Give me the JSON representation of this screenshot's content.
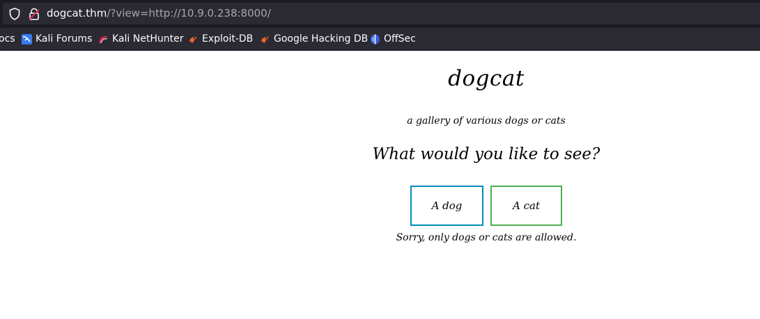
{
  "browser": {
    "url_host": "dogcat.thm",
    "url_path": "/?view=http://10.9.0.238:8000/",
    "icons": [
      "shield-icon",
      "lock-insecure-icon"
    ]
  },
  "bookmarks": [
    {
      "label": "ocs",
      "icon": ""
    },
    {
      "label": "Kali Forums",
      "icon": "kali-forums-icon"
    },
    {
      "label": "Kali NetHunter",
      "icon": "kali-nethunter-icon"
    },
    {
      "label": "Exploit-DB",
      "icon": "exploit-db-icon"
    },
    {
      "label": "Google Hacking DB",
      "icon": "ghdb-icon"
    },
    {
      "label": "OffSec",
      "icon": "offsec-icon"
    }
  ],
  "page": {
    "title": "dogcat",
    "tagline": "a gallery of various dogs or cats",
    "question": "What would you like to see?",
    "dog_button": "A dog",
    "cat_button": "A cat",
    "notice": "Sorry, only dogs or cats are allowed."
  },
  "colors": {
    "dog_border": "#008cba",
    "cat_border": "#4caf50"
  }
}
